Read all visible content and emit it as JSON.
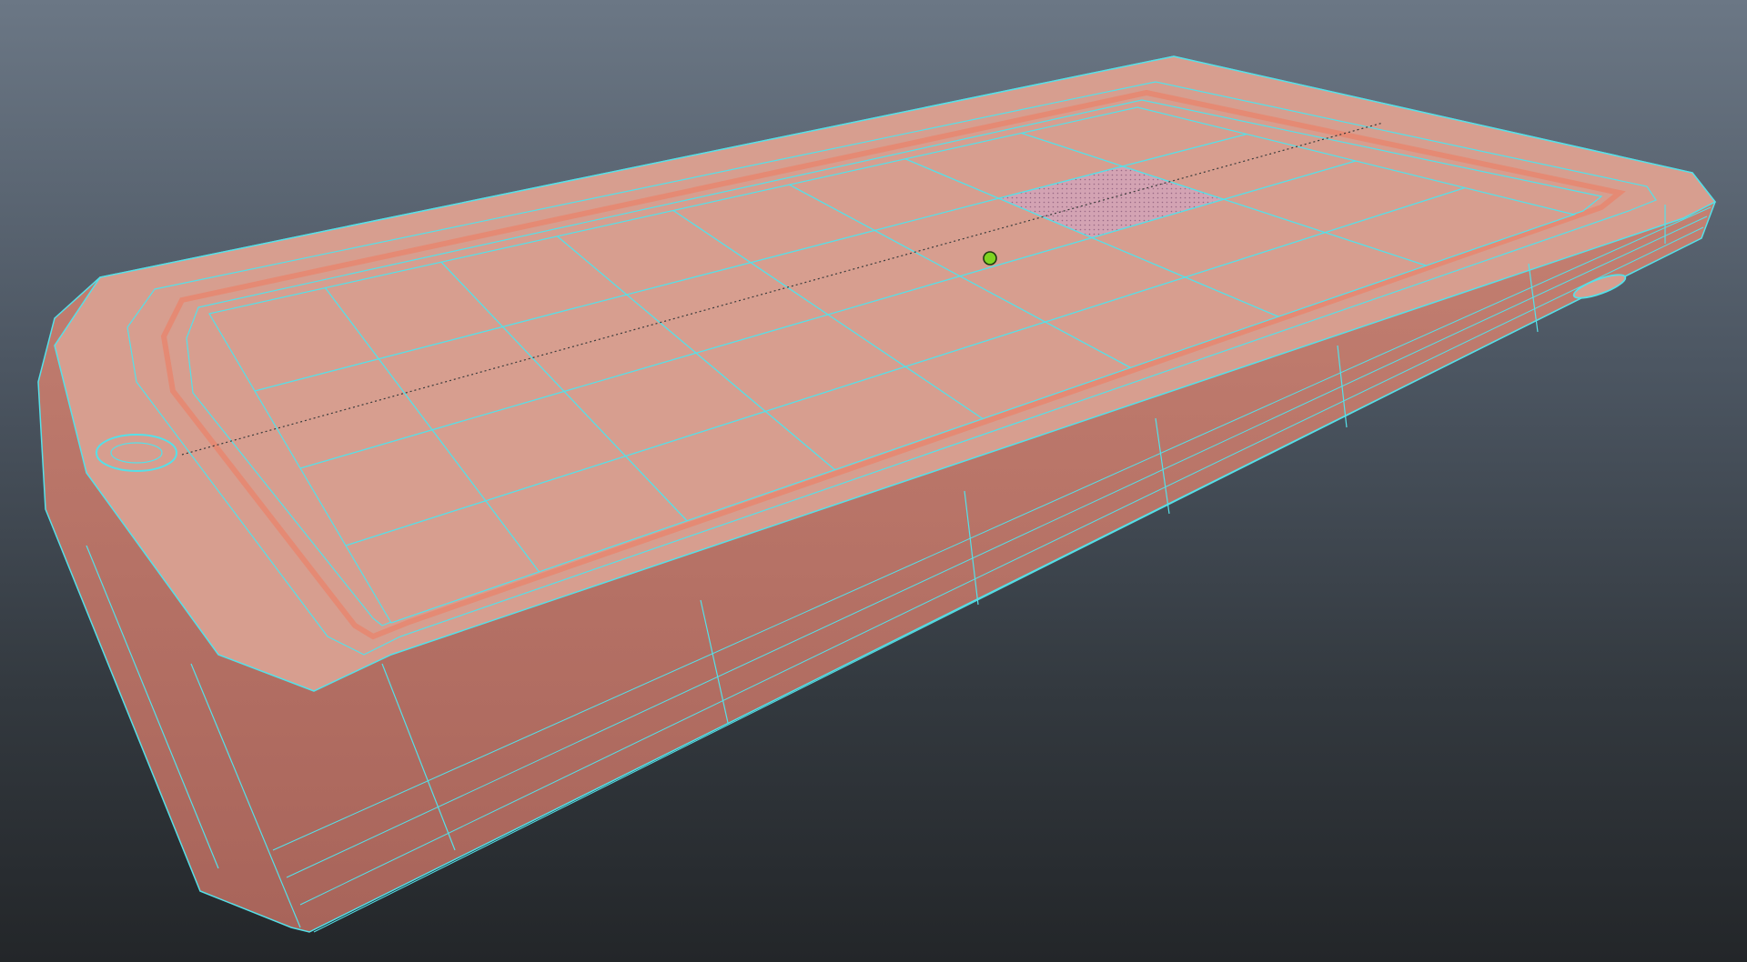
{
  "viewport": {
    "view": "perspective",
    "background": {
      "top": "#6b7785",
      "bottom": "#232629"
    }
  },
  "model": {
    "object": "phone-body",
    "shading": "smooth-shaded-with-wireframe",
    "surface_color": "#d79e8f",
    "side_color": "#c98576",
    "bezel_groove_color": "#e58a74",
    "wireframe_color": "#55e0e8",
    "selected_face_color": "#d3a3b3",
    "grid_divisions": {
      "length": 8,
      "width": 4
    },
    "details": [
      "speaker-slot",
      "edge-port",
      "screen-highlight-face",
      "corner-bevels"
    ]
  },
  "manipulator": {
    "type": "pivot-point",
    "color": "#7ed321"
  }
}
